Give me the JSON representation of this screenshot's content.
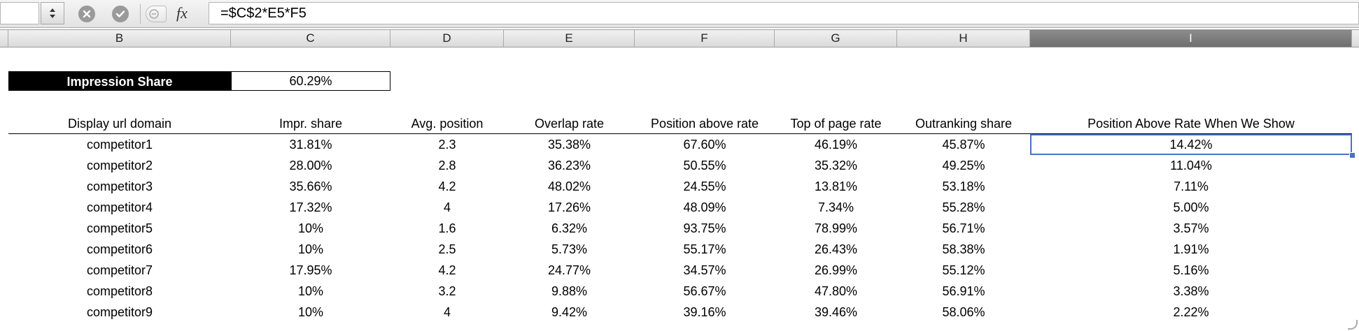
{
  "formula_bar": {
    "name_box": "",
    "formula": "=$C$2*E5*F5",
    "fx_label": "fx"
  },
  "column_headers": [
    "B",
    "C",
    "D",
    "E",
    "F",
    "G",
    "H",
    "I"
  ],
  "selected_column": "I",
  "impression_share": {
    "label": "Impression Share",
    "value": "60.29%"
  },
  "table": {
    "headers": [
      "Display url domain",
      "Impr. share",
      "Avg. position",
      "Overlap rate",
      "Position above rate",
      "Top of page rate",
      "Outranking share",
      "Position Above Rate When We Show"
    ],
    "rows": [
      [
        "competitor1",
        "31.81%",
        "2.3",
        "35.38%",
        "67.60%",
        "46.19%",
        "45.87%",
        "14.42%"
      ],
      [
        "competitor2",
        "28.00%",
        "2.8",
        "36.23%",
        "50.55%",
        "35.32%",
        "49.25%",
        "11.04%"
      ],
      [
        "competitor3",
        "35.66%",
        "4.2",
        "48.02%",
        "24.55%",
        "13.81%",
        "53.18%",
        "7.11%"
      ],
      [
        "competitor4",
        "17.32%",
        "4",
        "17.26%",
        "48.09%",
        "7.34%",
        "55.28%",
        "5.00%"
      ],
      [
        "competitor5",
        "10%",
        "1.6",
        "6.32%",
        "93.75%",
        "78.99%",
        "56.71%",
        "3.57%"
      ],
      [
        "competitor6",
        "10%",
        "2.5",
        "5.73%",
        "55.17%",
        "26.43%",
        "58.38%",
        "1.91%"
      ],
      [
        "competitor7",
        "17.95%",
        "4.2",
        "24.77%",
        "34.57%",
        "26.99%",
        "55.12%",
        "5.16%"
      ],
      [
        "competitor8",
        "10%",
        "3.2",
        "9.88%",
        "56.67%",
        "47.80%",
        "56.91%",
        "3.38%"
      ],
      [
        "competitor9",
        "10%",
        "4",
        "9.42%",
        "39.16%",
        "39.46%",
        "58.06%",
        "2.22%"
      ]
    ],
    "active_cell": {
      "row": 0,
      "col": 7
    }
  },
  "colors": {
    "selection": "#4a72c4",
    "label_bg": "#000000"
  }
}
